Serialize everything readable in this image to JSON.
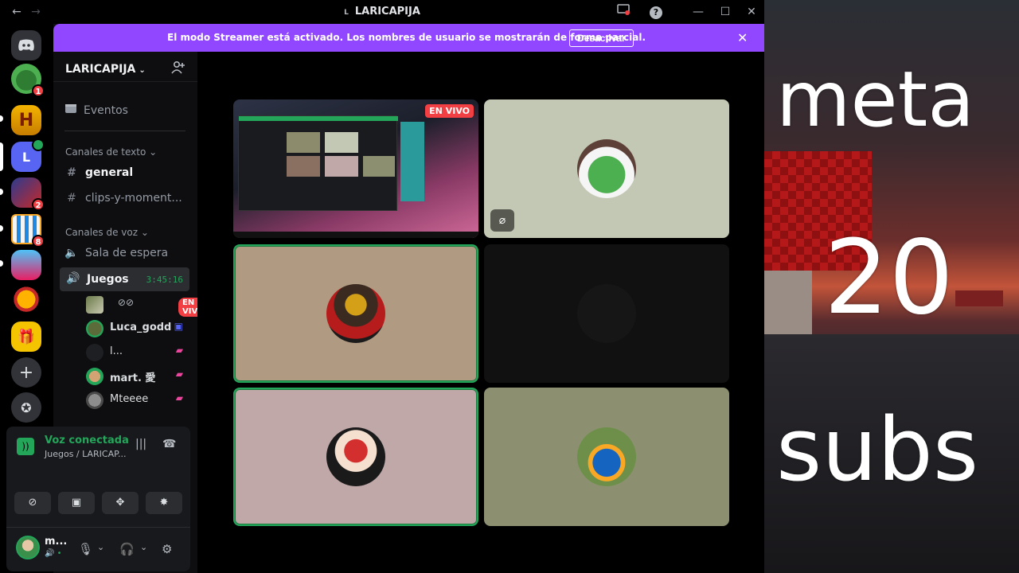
{
  "window": {
    "title": "LARICAPIJA",
    "back_glyph": "←",
    "forward_glyph": "→",
    "minimize_glyph": "—",
    "maximize_glyph": "☐",
    "close_glyph": "✕",
    "help_glyph": "?"
  },
  "streamer_bar": {
    "message": "El modo Streamer está activado. Los nombres de usuario se mostrarán de forma parcial.",
    "button_label": "Desactivar",
    "close_glyph": "✕",
    "color": "#9147ff"
  },
  "rail": {
    "servers": [
      {
        "name": "home",
        "icon": "discord-icon",
        "letter": "◉"
      },
      {
        "name": "profile",
        "icon": "frog-icon",
        "letter": "",
        "badge": "1"
      },
      {
        "name": "hypixel",
        "icon": "h-logo-icon",
        "letter": "H"
      },
      {
        "name": "L",
        "icon": "letter-l",
        "letter": "L",
        "voice": true
      },
      {
        "name": "roblox",
        "icon": "cube-icon",
        "letter": "",
        "badge": "2"
      },
      {
        "name": "club",
        "icon": "shield-icon",
        "letter": "",
        "badge": "8"
      },
      {
        "name": "game",
        "icon": "character-icon",
        "letter": ""
      },
      {
        "name": "pooh",
        "icon": "bear-icon",
        "letter": ""
      },
      {
        "name": "gift",
        "icon": "gift-icon",
        "letter": "🎁"
      }
    ],
    "add_glyph": "+",
    "explore_glyph": "✪"
  },
  "channels": {
    "server_name": "LARICAPIJA",
    "events_label": "Eventos",
    "text_category": "Canales de texto",
    "voice_category": "Canales de voz",
    "text_channels": [
      "general",
      "clips-y-moment..."
    ],
    "voice_channels": [
      "Sala de espera",
      "Juegos"
    ],
    "active_voice_timer": "3:45:16",
    "voice_users": [
      {
        "name": "",
        "live": "EN VIVO"
      },
      {
        "name": "Luca_godd"
      },
      {
        "name": "l..."
      },
      {
        "name": "mart. 愛"
      },
      {
        "name": "Mteeee"
      }
    ]
  },
  "panel": {
    "status": "Voz conectada",
    "sub": "Juegos / LARICAP...",
    "user_short": "m...",
    "status_dot": "•"
  },
  "stage": {
    "live_label": "EN VIVO",
    "cam_off_glyph": "⌀"
  },
  "overlay": {
    "line1": "meta",
    "line2": "20",
    "line3": "subs"
  }
}
